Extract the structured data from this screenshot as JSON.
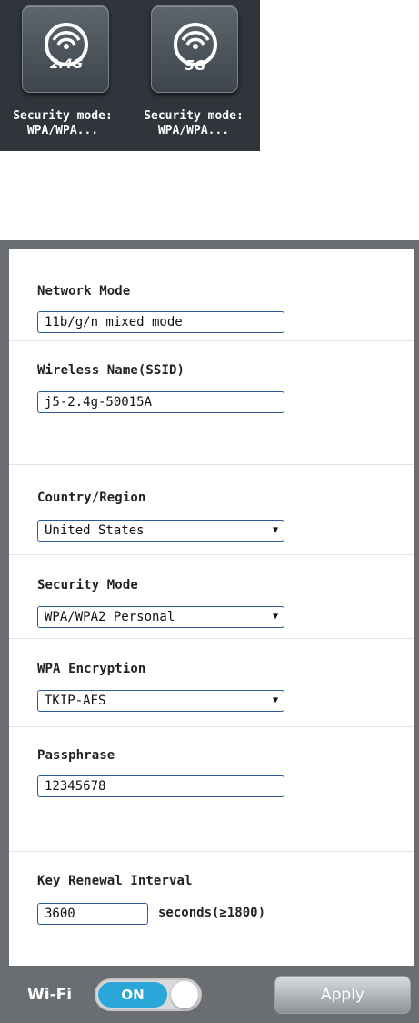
{
  "bands": [
    {
      "badge": "2.4G",
      "label_line1": "Security mode:",
      "label_line2": "WPA/WPA...",
      "icon": "wifi-signal-icon"
    },
    {
      "badge": "5G",
      "label_line1": "Security mode:",
      "label_line2": "WPA/WPA...",
      "icon": "wifi-signal-icon"
    }
  ],
  "form": {
    "network_mode": {
      "label": "Network Mode",
      "value": "11b/g/n mixed mode"
    },
    "ssid": {
      "label": "Wireless Name(SSID)",
      "value": "j5-2.4g-50015A"
    },
    "country": {
      "label": "Country/Region",
      "value": "United States"
    },
    "security_mode": {
      "label": "Security Mode",
      "value": "WPA/WPA2 Personal"
    },
    "wpa_encryption": {
      "label": "WPA Encryption",
      "value": "TKIP-AES"
    },
    "passphrase": {
      "label": "Passphrase",
      "value": "12345678"
    },
    "key_renewal": {
      "label": "Key Renewal Interval",
      "value": "3600",
      "unit": "seconds(≥1800)"
    }
  },
  "footer": {
    "wifi_label": "Wi-Fi",
    "toggle_state": "ON",
    "apply_label": "Apply"
  },
  "colors": {
    "band_bg": "#2f353b",
    "panel_bg": "#6a6e72",
    "field_border": "#2a5d9a",
    "toggle_on": "#2aa6d8"
  }
}
